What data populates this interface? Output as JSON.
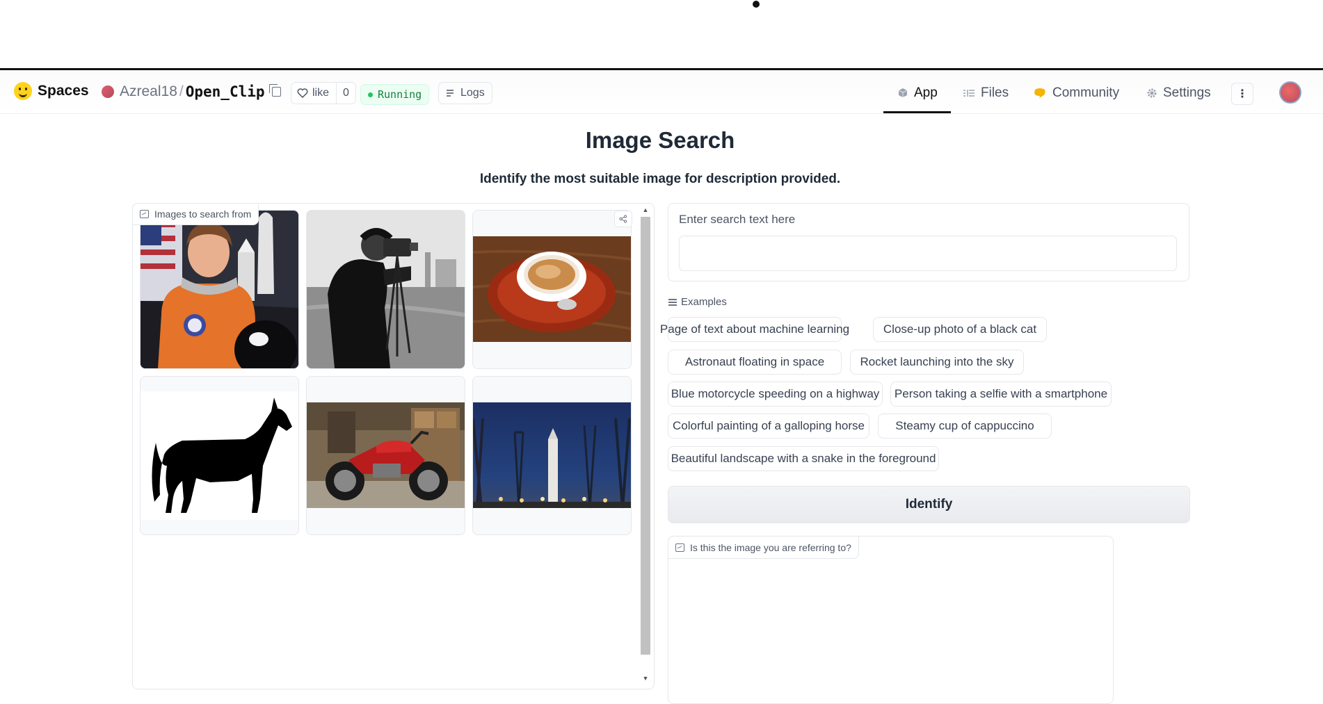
{
  "header": {
    "brand": "Spaces",
    "owner": "Azreal18",
    "separator": "/",
    "repo_name": "Open_Clip",
    "like_label": "like",
    "like_count": "0",
    "status": "Running",
    "logs_label": "Logs",
    "nav": [
      {
        "label": "App",
        "icon": "cube-icon",
        "active": true
      },
      {
        "label": "Files",
        "icon": "files-icon",
        "active": false
      },
      {
        "label": "Community",
        "icon": "community-icon",
        "active": false
      },
      {
        "label": "Settings",
        "icon": "gear-icon",
        "active": false
      }
    ],
    "menu_glyph": "⋮"
  },
  "main": {
    "title": "Image Search",
    "subtitle": "Identify the most suitable image for description provided."
  },
  "gallery": {
    "label": "Images to search from",
    "images": [
      {
        "name": "astronaut",
        "icon": "astronaut-photo"
      },
      {
        "name": "cameraman",
        "icon": "cameraman-photo"
      },
      {
        "name": "coffee",
        "icon": "coffee-photo"
      },
      {
        "name": "horse",
        "icon": "horse-silhouette"
      },
      {
        "name": "motorcycle",
        "icon": "motorcycle-photo"
      },
      {
        "name": "rocket",
        "icon": "rocket-photo"
      }
    ]
  },
  "search": {
    "label": "Enter search text here",
    "value": ""
  },
  "examples": {
    "label": "Examples",
    "items": [
      "Page of text about machine learning",
      "Close-up photo of a black cat",
      "Astronaut floating in space",
      "Rocket launching into the sky",
      "Blue motorcycle speeding on a highway",
      "Person taking a selfie with a smartphone",
      "Colorful painting of a galloping horse",
      "Steamy cup of cappuccino",
      "Beautiful landscape with a snake in the foreground"
    ]
  },
  "identify_label": "Identify",
  "output": {
    "label": "Is this the image you are referring to?"
  },
  "colors": {
    "running_bg": "#ecfdf3",
    "running_text": "#15803d",
    "border": "#e5e7eb"
  }
}
